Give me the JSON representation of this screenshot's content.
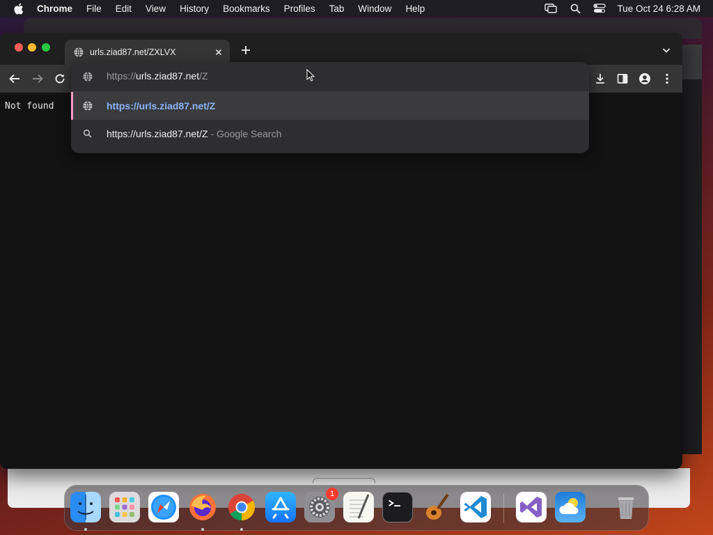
{
  "menubar": {
    "app_name": "Chrome",
    "items": [
      "File",
      "Edit",
      "View",
      "History",
      "Bookmarks",
      "Profiles",
      "Tab",
      "Window",
      "Help"
    ],
    "clock": "Tue Oct 24  6:28 AM",
    "status_icons": [
      "screen-mirroring-icon",
      "spotlight-search-icon",
      "control-center-icon"
    ]
  },
  "browser": {
    "tab": {
      "title": "urls.ziad87.net/ZXLVX",
      "favicon": "globe-icon"
    },
    "content_text": "Not found"
  },
  "omnibox": {
    "input": {
      "scheme": "https://",
      "host": "urls.ziad87.net",
      "path": "/Z"
    },
    "suggestions": [
      {
        "icon": "globe-icon",
        "text": "https://urls.ziad87.net/Z",
        "suffix": "",
        "selected": true
      },
      {
        "icon": "search-icon",
        "text": "https://urls.ziad87.net/Z",
        "suffix": " - Google Search",
        "selected": false
      }
    ]
  },
  "dock": {
    "apps": [
      "Finder",
      "Launchpad",
      "Safari",
      "Firefox",
      "Google Chrome",
      "App Store",
      "System Settings",
      "TextEdit",
      "Terminal",
      "GarageBand",
      "Visual Studio Code",
      "Visual Studio",
      "Weather",
      "Trash"
    ],
    "settings_badge": "1"
  },
  "colors": {
    "accent_link": "#8ab4f8",
    "selected_bar": "#f49ac1",
    "window_bg": "#121212",
    "toolbar_bg": "#353535"
  }
}
